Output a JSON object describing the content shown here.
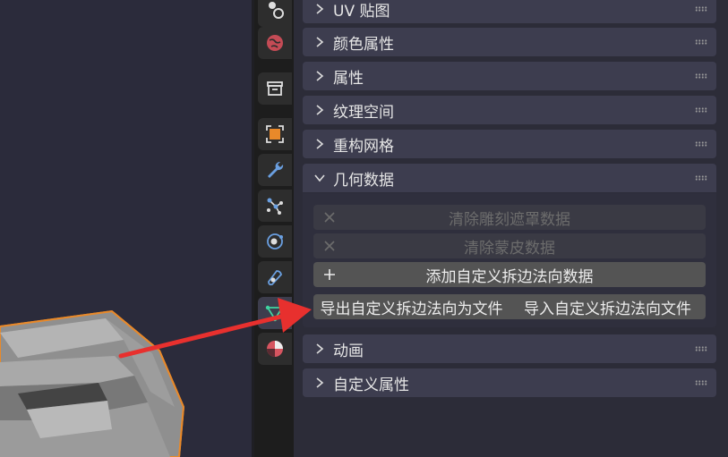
{
  "panels": {
    "uv_maps": "UV 贴图",
    "color_attributes": "颜色属性",
    "attributes": "属性",
    "texture_space": "纹理空间",
    "remesh": "重构网格",
    "geometry_data": "几何数据",
    "animation": "动画",
    "custom_properties": "自定义属性"
  },
  "geometry_data": {
    "clear_sculpt_mask": "清除雕刻遮罩数据",
    "clear_skin": "清除蒙皮数据",
    "add_custom_split_normals": "添加自定义拆边法向数据",
    "export_custom_normals": "导出自定义拆边法向为文件",
    "import_custom_normals": "导入自定义拆边法向文件"
  },
  "tabs": [
    {
      "icon": "physics-icon"
    },
    {
      "icon": "world-icon"
    },
    {
      "icon": "collection-icon"
    },
    {
      "icon": "object-icon"
    },
    {
      "icon": "modifier-wrench-icon"
    },
    {
      "icon": "particles-icon"
    },
    {
      "icon": "physics-orbit-icon"
    },
    {
      "icon": "constraints-icon"
    },
    {
      "icon": "mesh-data-icon",
      "active": true
    },
    {
      "icon": "material-icon"
    }
  ],
  "colors": {
    "viewport_bg": "#2b2b3b",
    "selection_outline": "#e8892a",
    "annotation_arrow": "#e8302e"
  }
}
